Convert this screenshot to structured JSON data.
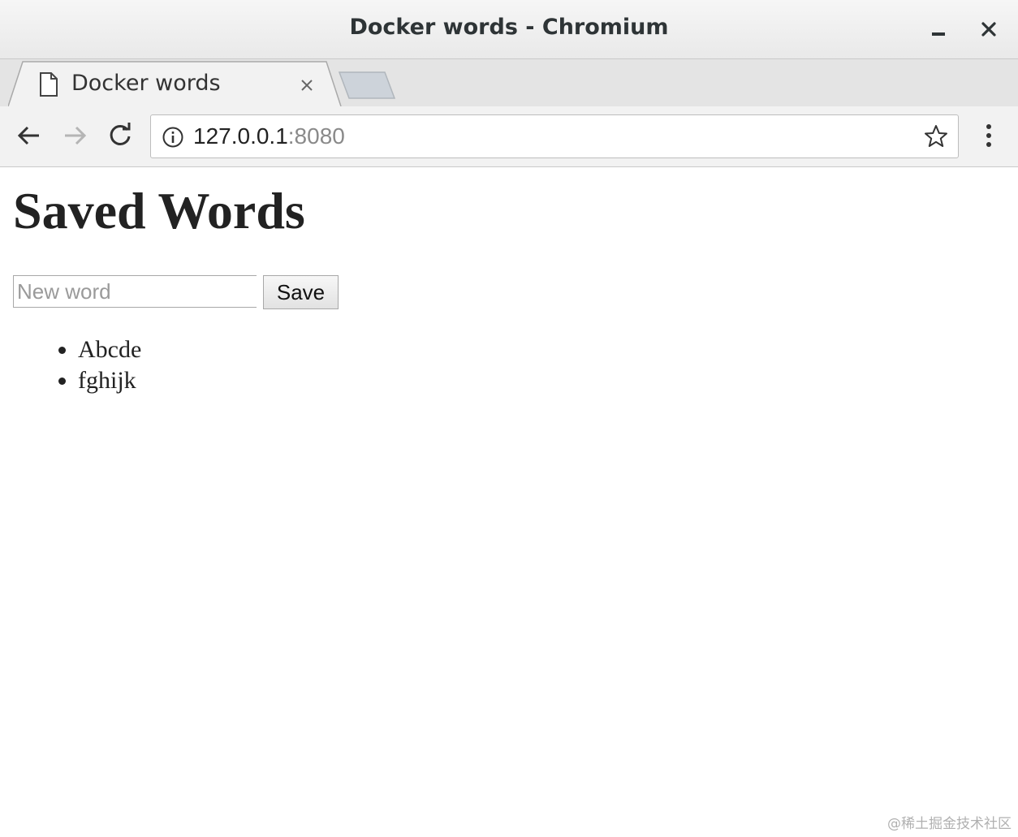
{
  "window": {
    "title": "Docker words - Chromium"
  },
  "tabs": [
    {
      "title": "Docker words"
    }
  ],
  "toolbar": {
    "url_host": "127.0.0.1",
    "url_port": ":8080"
  },
  "icons": {
    "minimize": "minimize-icon",
    "close_window": "close-icon",
    "page": "page-icon",
    "tab_close": "close-icon",
    "new_tab": "new-tab-icon",
    "profile": "person-icon",
    "back": "arrow-left-icon",
    "forward": "arrow-right-icon",
    "reload": "reload-icon",
    "site_info": "info-icon",
    "bookmark": "star-icon",
    "menu": "kebab-menu-icon"
  },
  "page": {
    "heading": "Saved Words",
    "input_placeholder": "New word",
    "input_value": "",
    "save_label": "Save",
    "words": [
      "Abcde",
      "fghijk"
    ]
  },
  "watermark": "@稀土掘金技术社区"
}
